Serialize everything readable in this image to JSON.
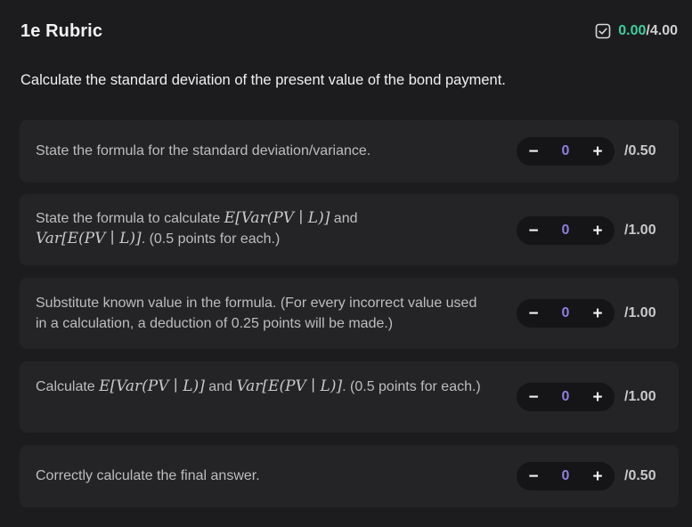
{
  "header": {
    "title": "1e Rubric",
    "score_earned": "0.00",
    "score_sep": "/",
    "score_max": "4.00",
    "check_icon": "checkbox-checked-icon",
    "earned_color": "#3ccf9b"
  },
  "question": "Calculate the standard deviation of the present value of the bond payment.",
  "items": [
    {
      "parts": [
        "State the formula for the standard deviation/variance."
      ],
      "value": "0",
      "max": "/0.50",
      "minus": "−",
      "plus": "+"
    },
    {
      "parts": [
        "State the formula to calculate ",
        "E[Var(PV ∣ L)]",
        " and ",
        "Var[E(PV ∣ L)]",
        ". (0.5 points for each.)"
      ],
      "value": "0",
      "max": "/1.00",
      "minus": "−",
      "plus": "+"
    },
    {
      "parts": [
        "Substitute known value in the formula. (For every incorrect value used in a calculation, a deduction of 0.25 points will be made.)"
      ],
      "value": "0",
      "max": "/1.00",
      "minus": "−",
      "plus": "+"
    },
    {
      "parts": [
        "Calculate ",
        "E[Var(PV ∣ L)]",
        " and ",
        "Var[E(PV ∣ L)]",
        ". (0.5 points for each.)"
      ],
      "value": "0",
      "max": "/1.00",
      "minus": "−",
      "plus": "+"
    },
    {
      "parts": [
        "Correctly calculate the final answer."
      ],
      "value": "0",
      "max": "/0.50",
      "minus": "−",
      "plus": "+"
    }
  ]
}
